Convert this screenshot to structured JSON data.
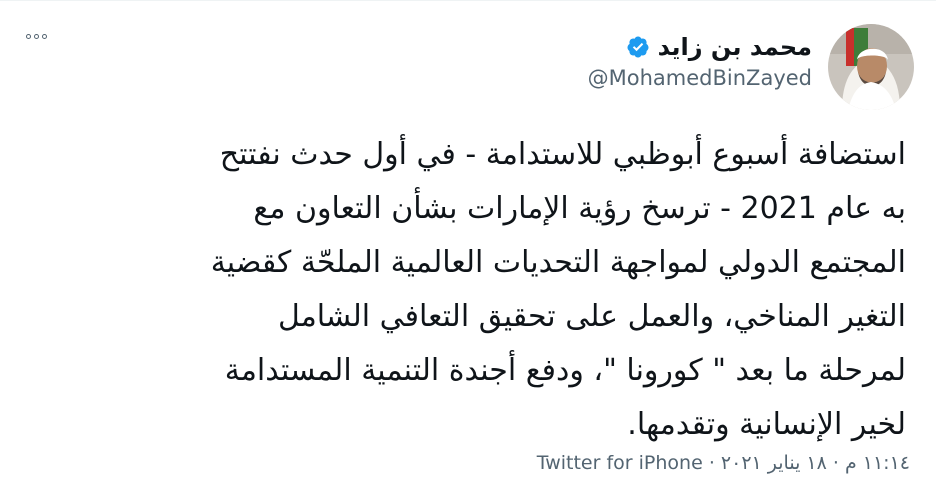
{
  "user": {
    "display_name": "محمد بن زايد",
    "handle": "@MohamedBinZayed",
    "verified": true
  },
  "tweet": {
    "text": "استضافة أسبوع أبوظبي للاستدامة - في أول حدث نفتتح\nبه عام 2021 - ترسخ رؤية الإمارات بشأن التعاون مع\nالمجتمع الدولي لمواجهة التحديات العالمية الملحّة كقضية\nالتغير المناخي، والعمل على تحقيق التعافي الشامل\nلمرحلة ما بعد \" كورونا \"، ودفع أجندة التنمية المستدامة\nلخير الإنسانية وتقدمها.",
    "timestamp": "١١:١٤ م · ١٨ يناير ٢٠٢١",
    "separator": "·",
    "source": "Twitter for iPhone"
  },
  "icons": {
    "more": "more-horizontal-icon",
    "verified": "verified-badge-icon"
  },
  "colors": {
    "verified_blue": "#1d9bf0",
    "secondary_text": "#536471",
    "primary_text": "#0f1419"
  }
}
